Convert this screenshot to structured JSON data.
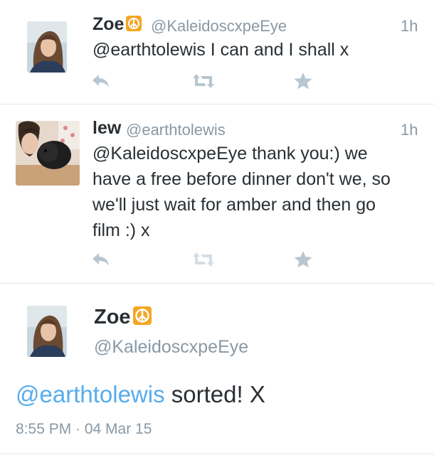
{
  "tweets": [
    {
      "name": "Zoe",
      "handle": "@KaleidoscxpeEye",
      "time": "1h",
      "text": "@earthtolewis I can and I shall x"
    },
    {
      "name": "lew",
      "handle": "@earthtolewis",
      "time": "1h",
      "text_lines": [
        "@KaleidoscxpeEye thank you:) we",
        "have a free before dinner don't we, so",
        "we'll just wait for amber and then go",
        "film :) x"
      ]
    }
  ],
  "detail": {
    "name": "Zoe",
    "handle": "@KaleidoscxpeEye",
    "mention": "@earthtolewis",
    "text": " sorted! X",
    "timestamp": "8:55 PM · 04 Mar 15"
  },
  "icons": {
    "reply": "reply-icon",
    "retweet": "retweet-icon",
    "favorite": "star-icon",
    "emoji": "peace-symbol-emoji"
  },
  "colors": {
    "link": "#55acee",
    "muted": "#8899a6",
    "action_icon": "#b8c6d1",
    "emoji_bg": "#f5a623"
  }
}
